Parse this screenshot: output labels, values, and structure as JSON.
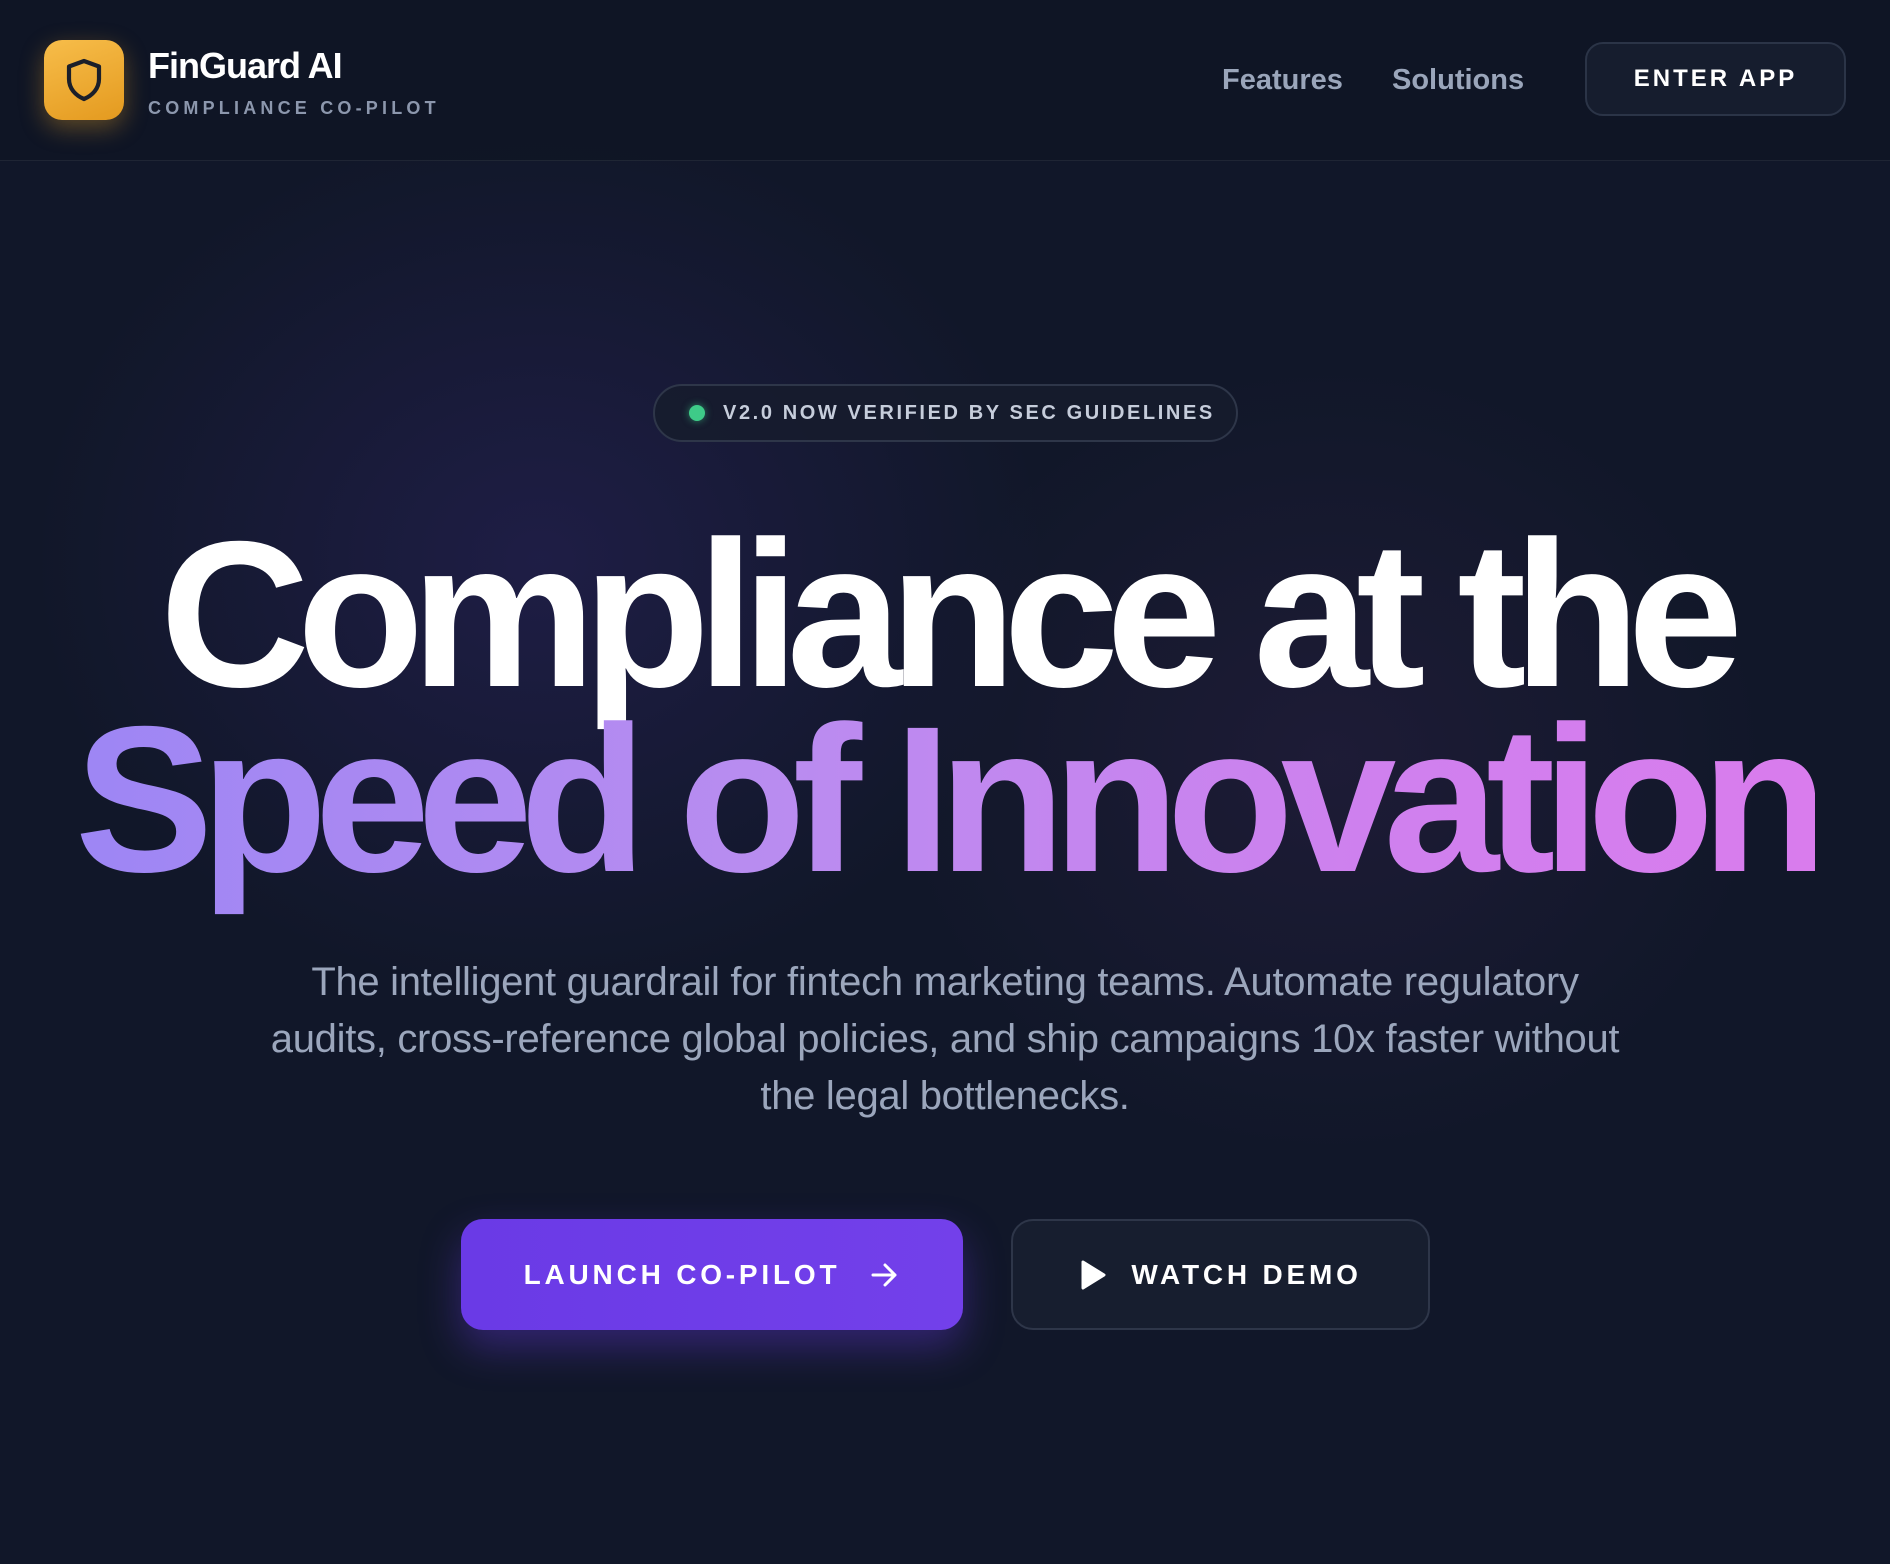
{
  "brand": {
    "name": "FinGuard AI",
    "tagline": "COMPLIANCE CO-PILOT",
    "logo_icon": "shield-icon",
    "logo_color": "#f0a92a"
  },
  "nav": {
    "items": [
      {
        "label": "Features"
      },
      {
        "label": "Solutions"
      }
    ],
    "cta_label": "ENTER APP"
  },
  "hero": {
    "badge": {
      "text": "V2.0 NOW VERIFIED BY SEC GUIDELINES",
      "status_color": "#3ecb88"
    },
    "headline_line1": "Compliance at the",
    "headline_line2": "Speed of Innovation",
    "subtitle": "The intelligent guardrail for fintech marketing teams. Automate regulatory audits, cross-reference global policies, and ship campaigns 10x faster without the legal bottlenecks.",
    "primary_cta": {
      "label": "LAUNCH CO-PILOT",
      "icon": "arrow-right-icon",
      "color": "#6d3be8"
    },
    "secondary_cta": {
      "label": "WATCH DEMO",
      "icon": "play-icon"
    }
  },
  "colors": {
    "background": "#111729",
    "accent_purple": "#6d3be8",
    "gradient_start": "#9d86f4",
    "gradient_end": "#d97ced"
  }
}
